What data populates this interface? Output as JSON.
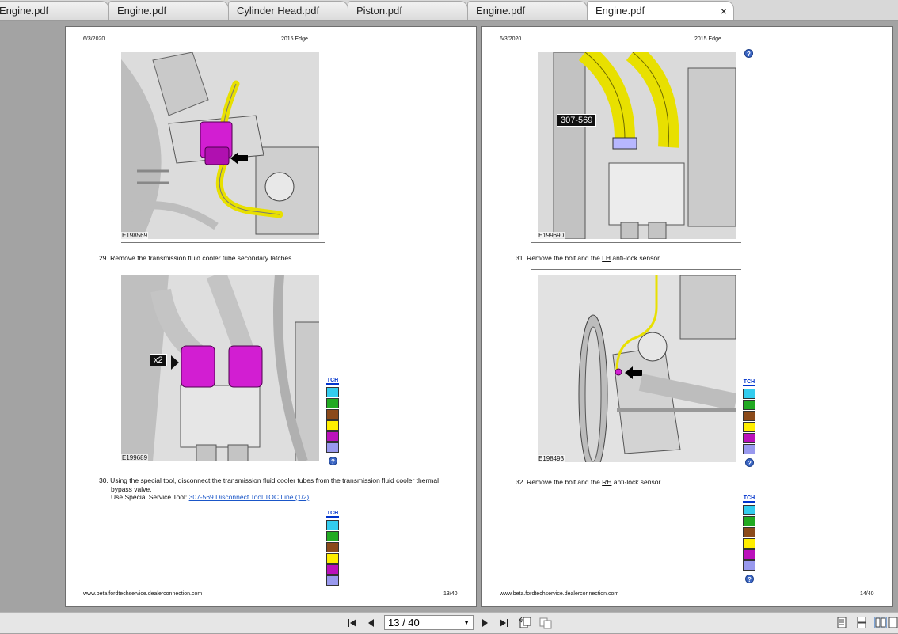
{
  "tabs": [
    {
      "label": "Engine.pdf",
      "active": false
    },
    {
      "label": "Engine.pdf",
      "active": false
    },
    {
      "label": "Cylinder Head.pdf",
      "active": false
    },
    {
      "label": "Piston.pdf",
      "active": false
    },
    {
      "label": "Engine.pdf",
      "active": false
    },
    {
      "label": "Engine.pdf",
      "active": true
    }
  ],
  "tab_close": "×",
  "left_page": {
    "date": "6/3/2020",
    "model": "2015 Edge",
    "fig1_id": "E198569",
    "step29": "29. Remove the transmission fluid cooler tube secondary latches.",
    "fig2_id": "E199689",
    "fig2_callout": "x2",
    "step30_line1": "30. Using the special tool, disconnect the transmission fluid cooler tubes from the transmission fluid cooler thermal",
    "step30_line2": "bypass valve.",
    "step30_line3_prefix": "Use Special Service Tool: ",
    "step30_link": "307-569  Disconnect Tool TOC Line (1/2)",
    "step30_line3_suffix": ".",
    "url": "www.beta.fordtechservice.dealerconnection.com",
    "page_num": "13/40"
  },
  "right_page": {
    "date": "6/3/2020",
    "model": "2015 Edge",
    "fig1_id": "E199690",
    "fig1_callout": "307-569",
    "step31_prefix": "31. Remove the bolt and the ",
    "step31_ul": "LH",
    "step31_suffix": " anti-lock sensor.",
    "fig2_id": "E198493",
    "step32_prefix": "32. Remove the bolt and the ",
    "step32_ul": "RH",
    "step32_suffix": " anti-lock sensor.",
    "url": "www.beta.fordtechservice.dealerconnection.com",
    "page_num": "14/40"
  },
  "palette": {
    "icon_label": "TCH",
    "colors": [
      "#33ccee",
      "#22aa22",
      "#8b4a1a",
      "#ffee00",
      "#bb11bb",
      "#9999ee"
    ]
  },
  "help_glyph": "?",
  "toolbar": {
    "page_value": "13 / 40",
    "icons": [
      "first-page-icon",
      "prev-page-icon",
      "next-page-icon",
      "last-page-icon",
      "rotate-icon",
      "copy-icon",
      "single-page-view-icon",
      "continuous-view-icon",
      "two-page-view-icon",
      "fit-page-icon"
    ]
  },
  "colors": {
    "tube_yellow": "#e8e000",
    "latch_magenta": "#d21ed2",
    "background": "#a3a3a3"
  }
}
